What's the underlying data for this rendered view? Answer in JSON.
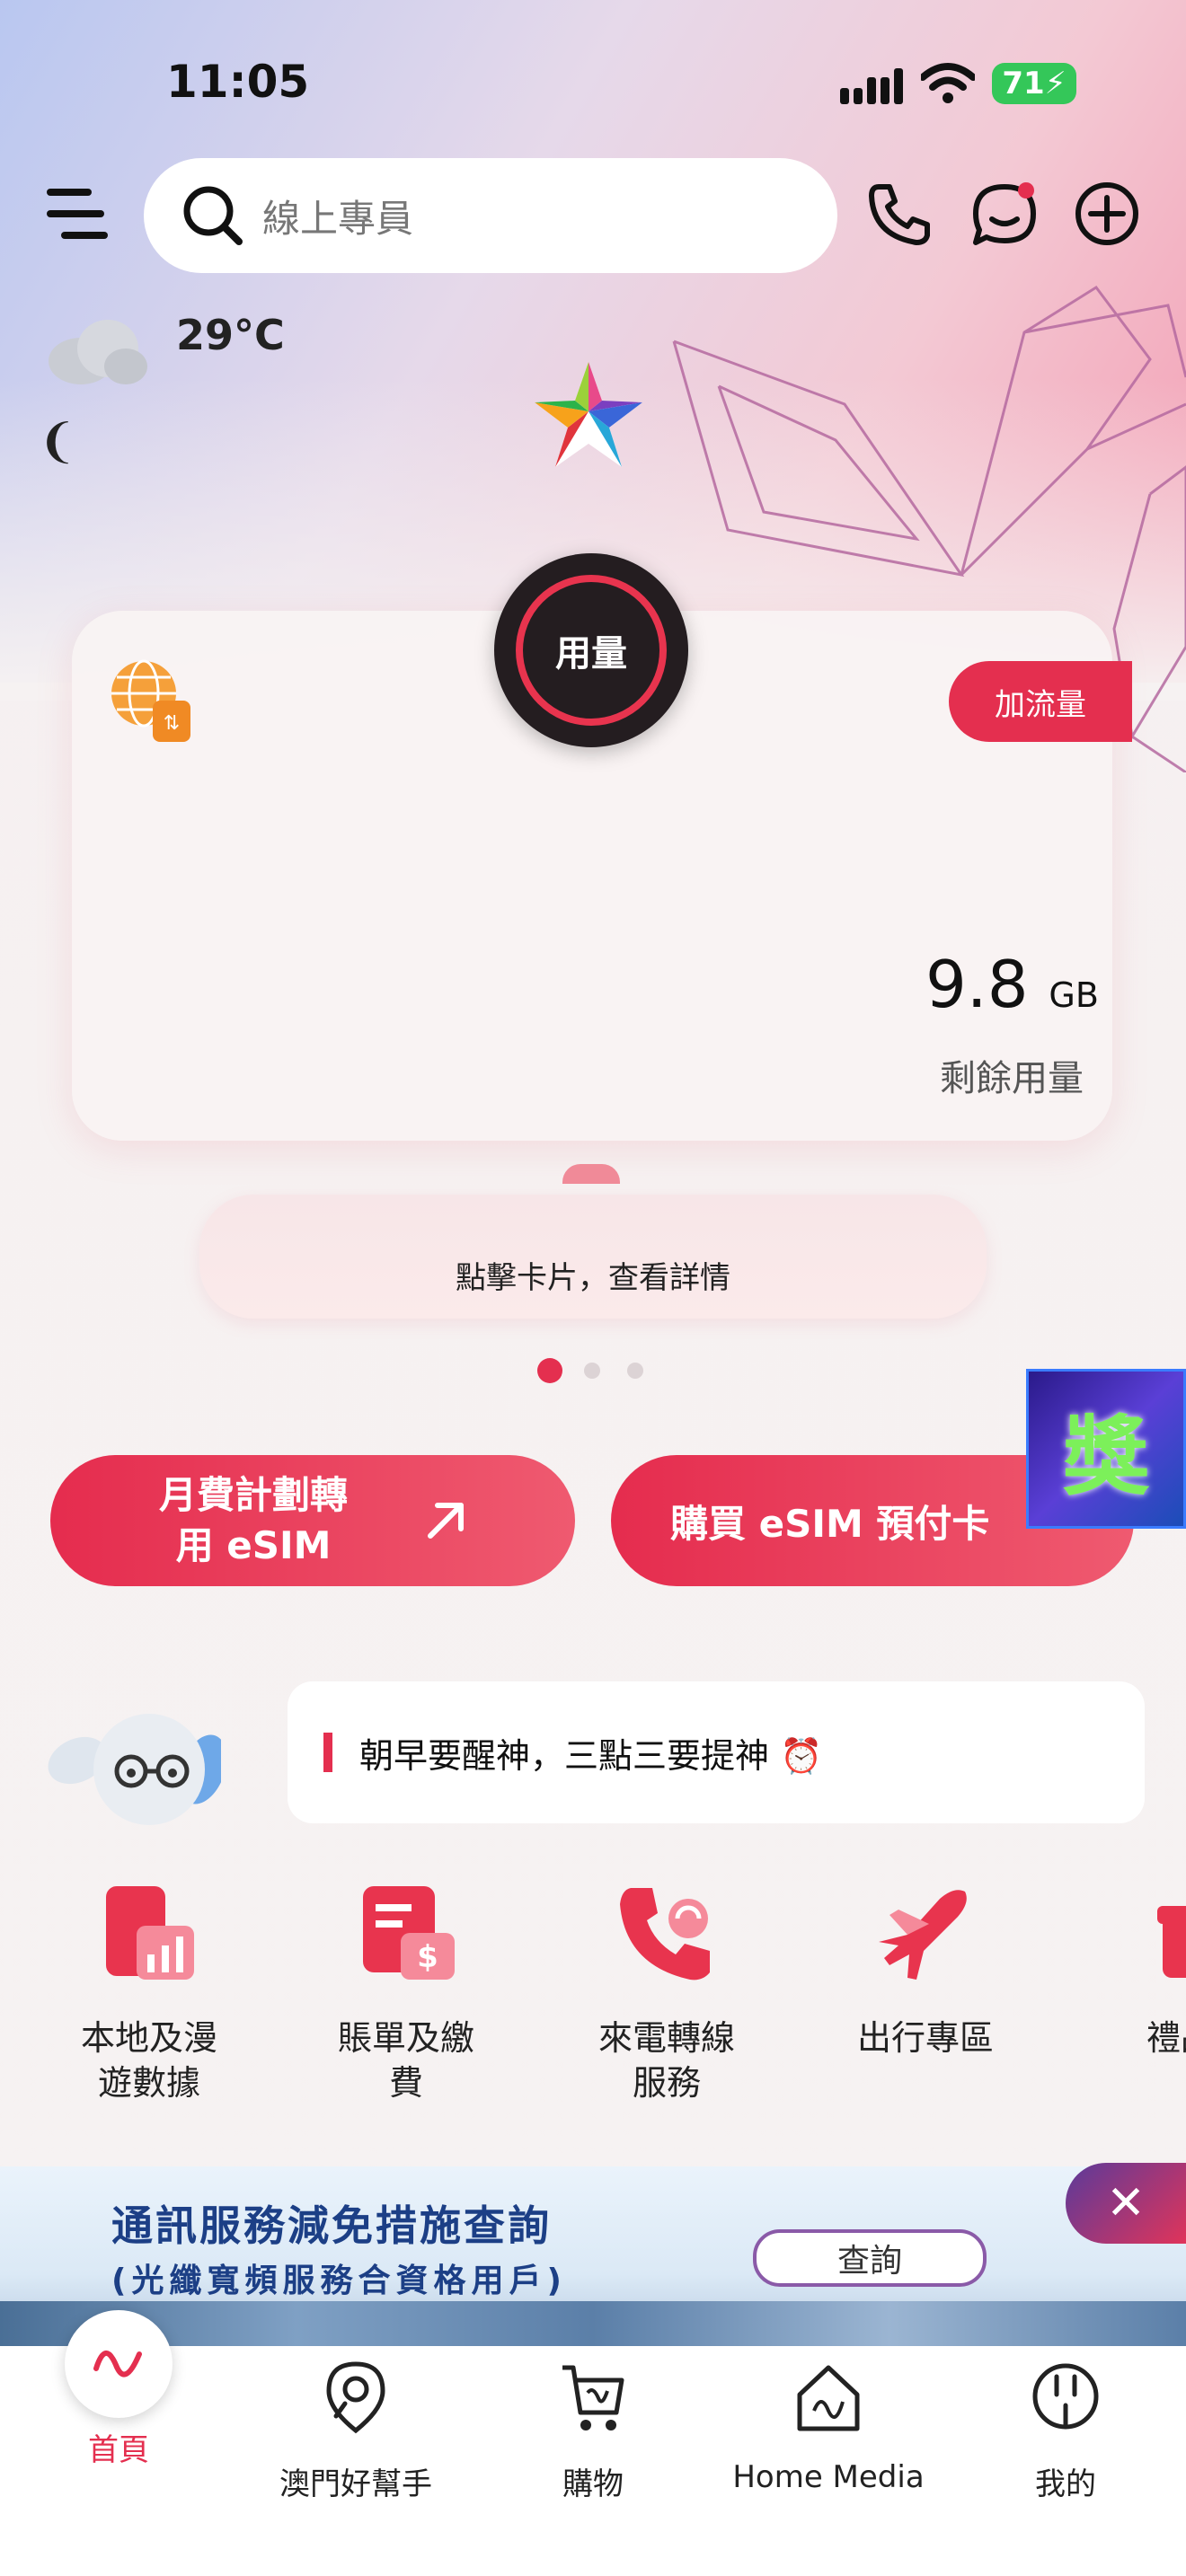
{
  "status_bar": {
    "time": "11:05",
    "battery": "71"
  },
  "header": {
    "search_placeholder": "線上專員"
  },
  "weather": {
    "temperature": "29°C"
  },
  "usage_card": {
    "badge_label": "用量",
    "add_data_label": "加流量",
    "remaining_value": "9.8",
    "remaining_unit": "GB",
    "remaining_label": "剩餘用量",
    "detail_hint": "點擊卡片，查看詳情"
  },
  "actions": {
    "esim_transfer_line1": "月費計劃轉",
    "esim_transfer_line2": "用 eSIM",
    "buy_esim_label": "購買 eSIM 預付卡",
    "reward_label": "獎"
  },
  "assistant": {
    "message": "朝早要醒神，三點三要提神 ⏰"
  },
  "services": [
    {
      "line1": "本地及漫",
      "line2": "遊數據"
    },
    {
      "line1": "賬單及繳費",
      "line2": ""
    },
    {
      "line1": "來電轉線",
      "line2": "服務"
    },
    {
      "line1": "出行專區",
      "line2": ""
    },
    {
      "line1": "禮品",
      "line2": ""
    }
  ],
  "banner": {
    "title": "通訊服務減免措施查詢",
    "subtitle": "(光纖寬頻服務合資格用戶)",
    "button": "查詢"
  },
  "tabs": [
    "首頁",
    "澳門好幫手",
    "購物",
    "Home Media",
    "我的"
  ],
  "colors": {
    "accent": "#e42f4f",
    "tab_active": "#e42f4f"
  }
}
